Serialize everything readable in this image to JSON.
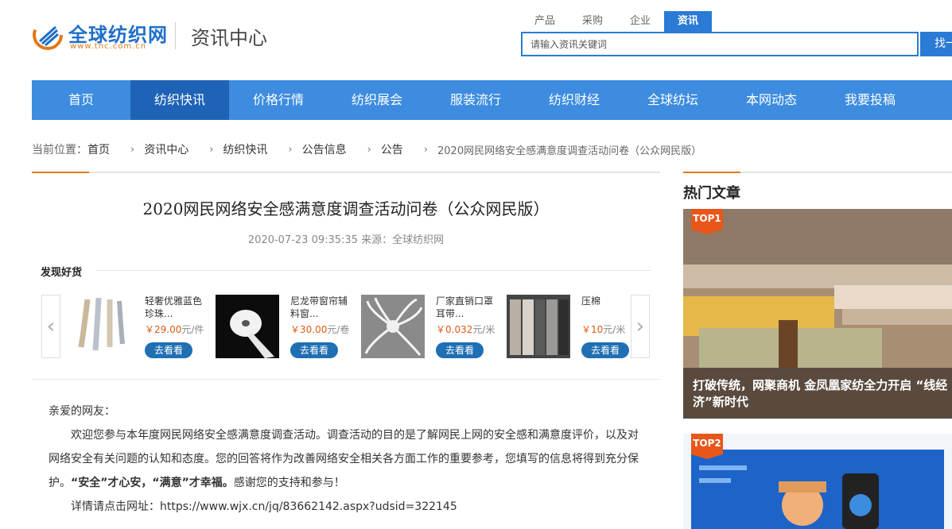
{
  "header": {
    "logo_text": "全球纺织网",
    "logo_url": "www.tnc.com.cn",
    "section_title": "资讯中心",
    "search_tabs": [
      "产品",
      "采购",
      "企业",
      "资讯"
    ],
    "search_placeholder": "请输入资讯关键词",
    "search_button": "找一",
    "brand_color": "#2a7ad6"
  },
  "nav": {
    "items": [
      "首页",
      "纺织快讯",
      "价格行情",
      "纺织展会",
      "服装流行",
      "纺织财经",
      "全球纺坛",
      "本网动态",
      "我要投稿"
    ]
  },
  "breadcrumb": {
    "label": "当前位置：",
    "items": [
      "首页",
      "资讯中心",
      "纺织快讯",
      "公告信息",
      "公告",
      "2020网民网络安全感满意度调查活动问卷（公众网民版）"
    ]
  },
  "article": {
    "title": "2020网民网络安全感满意度调查活动问卷（公众网民版）",
    "meta": "2020-07-23 09:35:35 来源：全球纺织网",
    "goods": {
      "title": "发现好货",
      "items": [
        {
          "name": "轻奢优雅蓝色珍珠...",
          "price": "29.00",
          "unit": "元/件",
          "button": "去看看"
        },
        {
          "name": "尼龙带窗帘辅料窗...",
          "price": "30.00",
          "unit": "元/卷",
          "button": "去看看"
        },
        {
          "name": "厂家直销口罩耳带...",
          "price": "0.032",
          "unit": "元/米",
          "button": "去看看"
        },
        {
          "name": "压棉",
          "price": "10",
          "unit": "元/米",
          "button": "去看看"
        }
      ],
      "currency": "￥"
    },
    "greeting": "亲爱的网友：",
    "para1": "欢迎您参与本年度网民网络安全感满意度调查活动。调查活动的目的是了解网民上网的安全感和满意度评价，以及对网络安全有关问题的认知和态度。您的回答将作为改善网络安全相关各方面工作的重要参考，您填写的信息将得到充分保护。",
    "para1_bold": "“安全”才心安，“满意”才幸福。",
    "para1_end": "感谢您的支持和参与！",
    "link_label": "详情请点击网址：",
    "link_url": "https://www.wjx.cn/jq/83662142.aspx?udsid=322145"
  },
  "sidebar": {
    "title": "热门文章",
    "hot": [
      {
        "badge": "TOP1",
        "caption": "打破传统，网聚商机 金凤凰家纺全力开启 “线经济”新时代"
      },
      {
        "badge": "TOP2",
        "caption": ""
      }
    ]
  }
}
